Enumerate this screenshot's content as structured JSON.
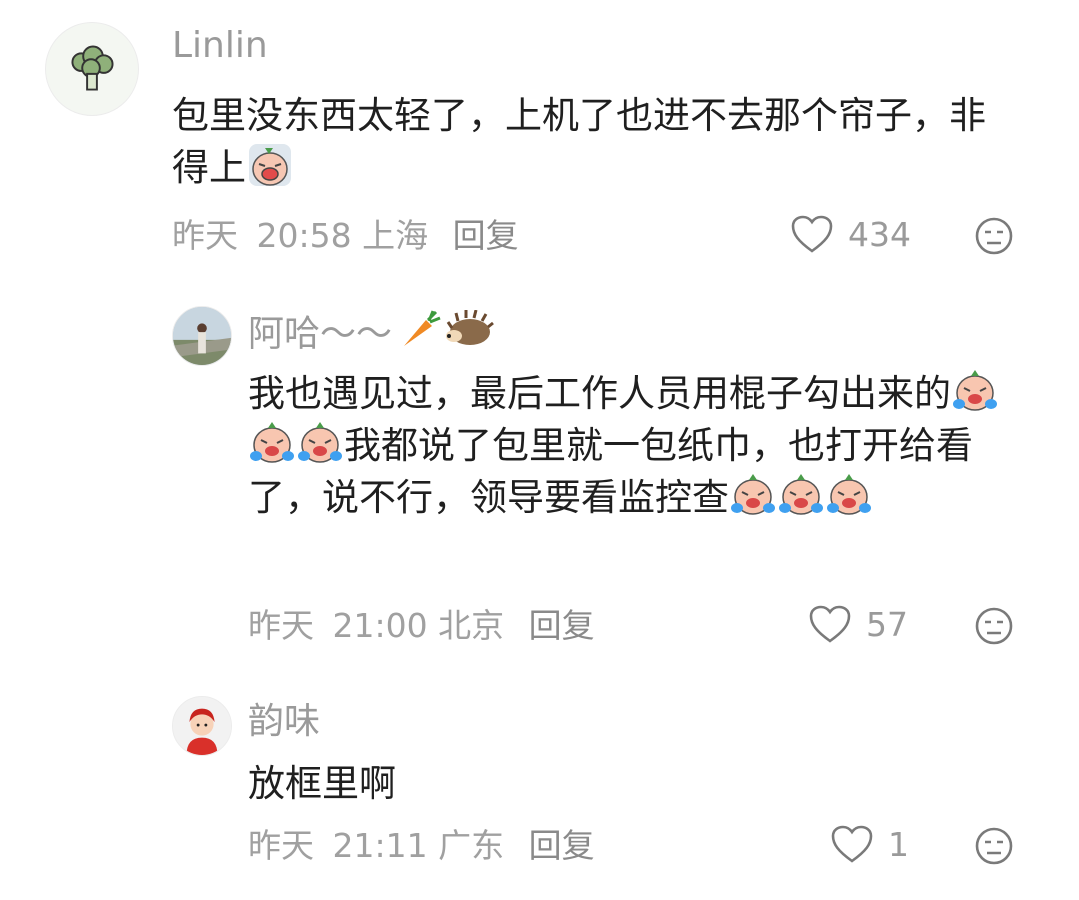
{
  "comments": [
    {
      "username": "Linlin",
      "avatar_icon": "broccoli-avatar",
      "content": [
        "包里没东西太轻了，上机了也进不去那个帘子，非得上",
        "[emoji:grimace]"
      ],
      "date": "昨天",
      "time": "20:58",
      "location": "上海",
      "reply_label": "回复",
      "likes": "434"
    },
    {
      "username": "阿哈～～",
      "username_emojis": [
        "carrot-icon",
        "hedgehog-icon"
      ],
      "avatar_icon": "person-photo-avatar",
      "content": [
        "我也遇见过，最后工作人员用棍子勾出来的",
        "[emoji:cry]",
        "[emoji:cry]",
        "[emoji:cry]",
        "我都说了包里就一包纸巾，也打开给看了，说不行，领导要看监控查",
        "[emoji:cry]",
        "[emoji:cry]",
        "[emoji:cry]"
      ],
      "date": "昨天",
      "time": "21:00",
      "location": "北京",
      "reply_label": "回复",
      "likes": "57"
    },
    {
      "username": "韵味",
      "avatar_icon": "cartoon-child-avatar",
      "content": [
        "放框里啊"
      ],
      "date": "昨天",
      "time": "21:11",
      "location": "广东",
      "reply_label": "回复",
      "likes": "1"
    }
  ]
}
